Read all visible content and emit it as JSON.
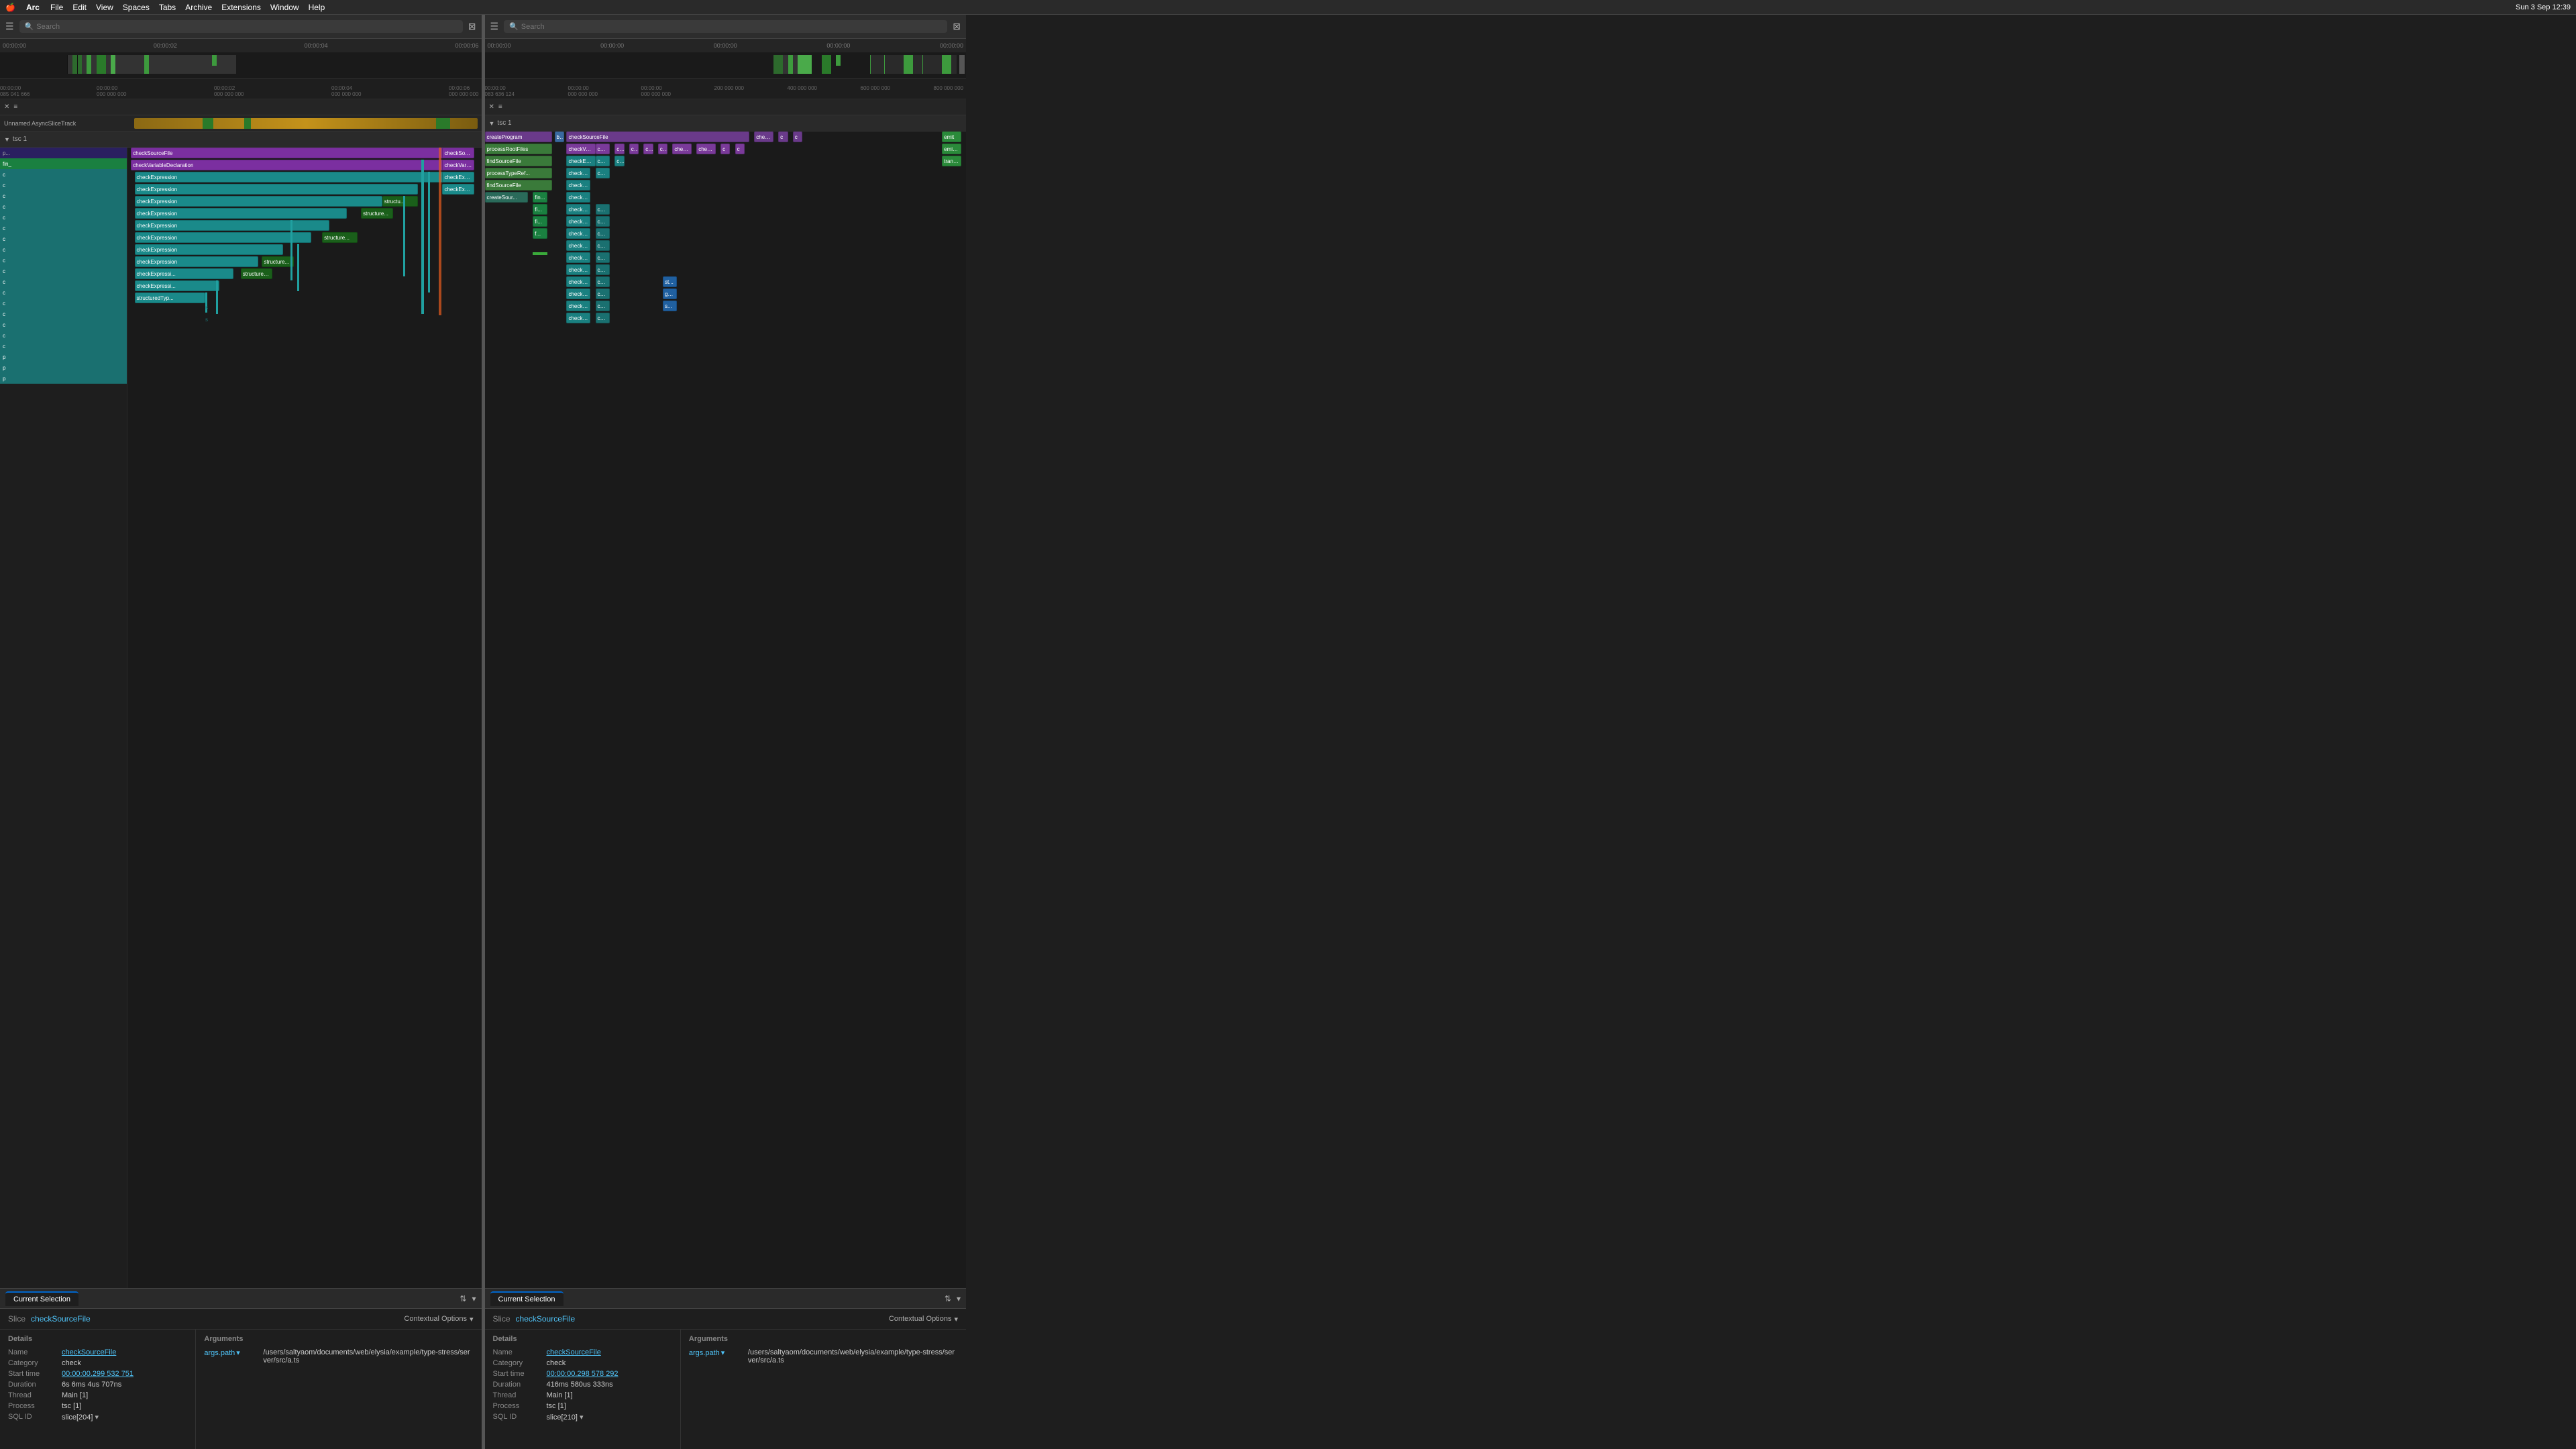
{
  "menuBar": {
    "apple": "🍎",
    "appName": "Arc",
    "menus": [
      "File",
      "Edit",
      "View",
      "Spaces",
      "Tabs",
      "Archive",
      "Extensions",
      "Window",
      "Help"
    ],
    "activeMenu": "Arc",
    "rightItems": [
      "Sun 3 Sep  12:39"
    ],
    "searchPlaceholder": "Search"
  },
  "panels": [
    {
      "id": "left",
      "toolbar": {
        "hamburgerLabel": "☰",
        "searchPlaceholder": "Search"
      },
      "timeRuler": {
        "marks": [
          "00:00:00",
          "00:00:02",
          "00:00:04",
          "00:00:06"
        ]
      },
      "timeIndicators": {
        "top": [
          "00:00:00",
          "085 041 666"
        ],
        "marks": [
          "00:00:00\n000 000 000",
          "00:00:02\n000 000 000",
          "00:00:04\n000 000 000",
          "00:00:06\n000 000 000"
        ]
      },
      "trackControls": {
        "closeLabel": "✕",
        "listLabel": "≡"
      },
      "asyncTrack": {
        "label": "Unnamed AsyncSliceTrack"
      },
      "tscGroup": {
        "label": "tsc 1",
        "expandIcon": "▼"
      },
      "currentSelection": {
        "tabLabel": "Current Selection"
      },
      "slice": {
        "typeLabel": "Slice",
        "name": "checkSourceFile",
        "contextualOptionsLabel": "Contextual Options",
        "contextualOptionsIcon": "▾"
      },
      "details": {
        "sectionTitle": "Details",
        "fields": [
          {
            "label": "Name",
            "value": "checkSourceFile",
            "isLink": true
          },
          {
            "label": "Category",
            "value": "check"
          },
          {
            "label": "Start time",
            "value": "00:00:00.299 532 751",
            "isLink": true
          },
          {
            "label": "Duration",
            "value": "6s 6ms 4us 707ns"
          },
          {
            "label": "Thread",
            "value": "Main [1]"
          },
          {
            "label": "Process",
            "value": "tsc [1]"
          },
          {
            "label": "SQL ID",
            "value": "slice[204]",
            "isLink": true,
            "hasDropdown": true
          }
        ]
      },
      "arguments": {
        "sectionTitle": "Arguments",
        "args": [
          {
            "key": "args.path",
            "hasDropdown": true,
            "value": "/users/saltyaom/documents/web/elysia/example/type-stress/server/src/a.ts"
          }
        ]
      }
    },
    {
      "id": "right",
      "toolbar": {
        "hamburgerLabel": "☰",
        "searchPlaceholder": "Search"
      },
      "timeRuler": {
        "marks": [
          "00:00:00",
          "00:00:00",
          "00:00:00",
          "00:00:00",
          "00:00:00"
        ]
      },
      "timeIndicators": {
        "top": [
          "00:00:00",
          "083 636 124"
        ],
        "marks": [
          "00:00:00\n000 000 000",
          "00:00:00\n000 000 000",
          "200 000 000",
          "400 000 000",
          "600 000 000",
          "800 000 000"
        ]
      },
      "trackControls": {
        "closeLabel": "✕",
        "listLabel": "≡"
      },
      "tscGroup": {
        "label": "tsc 1",
        "expandIcon": "▼"
      },
      "currentSelection": {
        "tabLabel": "Current Selection"
      },
      "slice": {
        "typeLabel": "Slice",
        "name": "checkSourceFile",
        "contextualOptionsLabel": "Contextual Options",
        "contextualOptionsIcon": "▾"
      },
      "details": {
        "sectionTitle": "Details",
        "fields": [
          {
            "label": "Name",
            "value": "checkSourceFile",
            "isLink": true
          },
          {
            "label": "Category",
            "value": "check"
          },
          {
            "label": "Start time",
            "value": "00:00:00.298 578 292",
            "isLink": true
          },
          {
            "label": "Duration",
            "value": "416ms 580us 333ns"
          },
          {
            "label": "Thread",
            "value": "Main [1]"
          },
          {
            "label": "Process",
            "value": "tsc [1]"
          },
          {
            "label": "SQL ID",
            "value": "slice[210]",
            "isLink": true,
            "hasDropdown": true
          }
        ]
      },
      "arguments": {
        "sectionTitle": "Arguments",
        "args": [
          {
            "key": "args.path",
            "hasDropdown": true,
            "value": "/users/saltyaom/documents/web/elysia/example/type-stress/server/src/a.ts"
          }
        ]
      }
    }
  ],
  "flameColors": {
    "purple": "#7b2fa0",
    "teal": "#1a9898",
    "green": "#2a8a3a",
    "blue": "#1a5fa0",
    "cyan": "#1a9090",
    "selected": "#e85d20"
  },
  "icons": {
    "filter": "⇅",
    "chevronDown": "▾",
    "expand": "▼",
    "collapse": "▶",
    "close": "✕",
    "menu": "≡",
    "hamburger": "☰",
    "search": "🔍",
    "dropdown": "▾"
  }
}
